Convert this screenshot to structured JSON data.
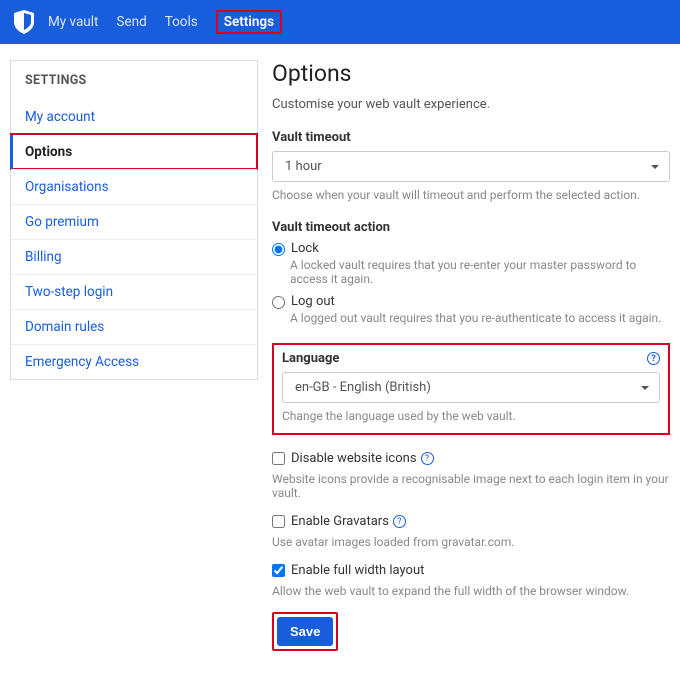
{
  "nav": {
    "items": [
      {
        "label": "My vault",
        "active": false
      },
      {
        "label": "Send",
        "active": false
      },
      {
        "label": "Tools",
        "active": false
      },
      {
        "label": "Settings",
        "active": true,
        "highlight": true
      }
    ]
  },
  "sidebar": {
    "title": "SETTINGS",
    "items": [
      {
        "label": "My account"
      },
      {
        "label": "Options",
        "selected": true,
        "highlight": true
      },
      {
        "label": "Organisations"
      },
      {
        "label": "Go premium"
      },
      {
        "label": "Billing"
      },
      {
        "label": "Two-step login"
      },
      {
        "label": "Domain rules"
      },
      {
        "label": "Emergency Access"
      }
    ]
  },
  "options": {
    "title": "Options",
    "subtitle": "Customise your web vault experience.",
    "vaultTimeout": {
      "label": "Vault timeout",
      "value": "1 hour",
      "help": "Choose when your vault will timeout and perform the selected action."
    },
    "vaultTimeoutAction": {
      "label": "Vault timeout action",
      "options": [
        {
          "label": "Lock",
          "help": "A locked vault requires that you re-enter your master password to access it again.",
          "checked": true
        },
        {
          "label": "Log out",
          "help": "A logged out vault requires that you re-authenticate to access it again.",
          "checked": false
        }
      ]
    },
    "language": {
      "label": "Language",
      "value": "en-GB - English (British)",
      "help": "Change the language used by the web vault."
    },
    "disableIcons": {
      "label": "Disable website icons",
      "help": "Website icons provide a recognisable image next to each login item in your vault.",
      "checked": false,
      "info": true
    },
    "gravatars": {
      "label": "Enable Gravatars",
      "help": "Use avatar images loaded from gravatar.com.",
      "checked": false,
      "info": true
    },
    "fullWidth": {
      "label": "Enable full width layout",
      "help": "Allow the web vault to expand the full width of the browser window.",
      "checked": true
    },
    "saveLabel": "Save"
  }
}
